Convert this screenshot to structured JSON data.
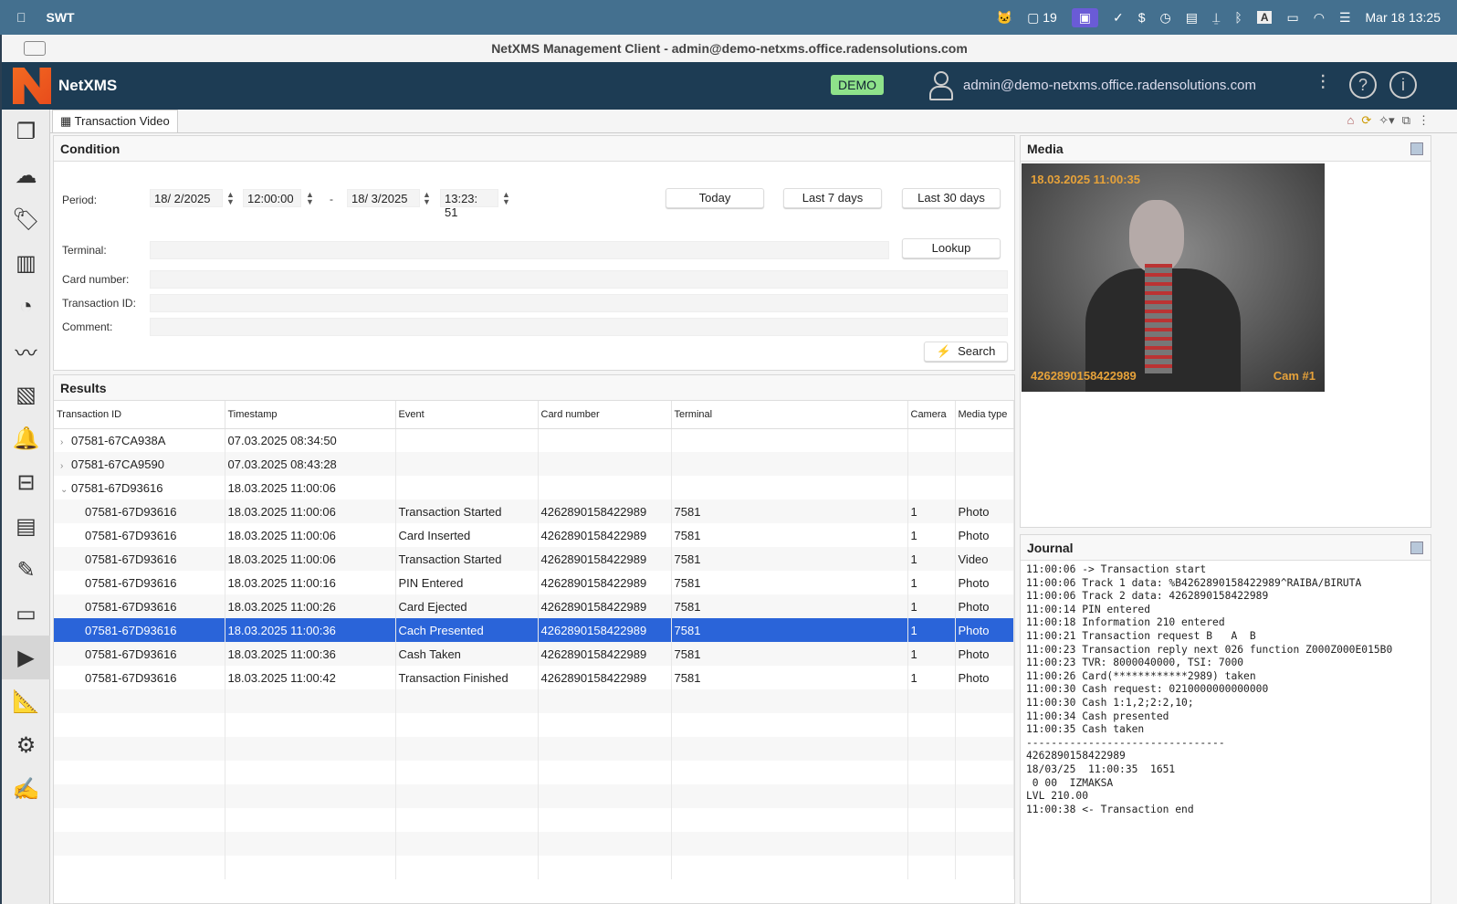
{
  "menubar": {
    "app": "SWT",
    "badge_count": "19",
    "datetime": "Mar 18  13:25",
    "input_indicator": "A"
  },
  "window": {
    "title": "NetXMS Management Client - admin@demo-netxms.office.radensolutions.com"
  },
  "header": {
    "brand": "NetXMS",
    "demo_badge": "DEMO",
    "user": "admin@demo-netxms.office.radensolutions.com"
  },
  "tab": {
    "label": "Transaction Video"
  },
  "condition": {
    "title": "Condition",
    "period_label": "Period:",
    "date_from": "18/ 2/2025",
    "time_from": "12:00:00",
    "separator": "-",
    "date_to": "18/ 3/2025",
    "time_to": "13:23: 51",
    "today": "Today",
    "last7": "Last 7 days",
    "last30": "Last 30 days",
    "terminal_label": "Terminal:",
    "terminal_value": "",
    "lookup": "Lookup",
    "card_label": "Card number:",
    "card_value": "",
    "txid_label": "Transaction ID:",
    "txid_value": "",
    "comment_label": "Comment:",
    "comment_value": "",
    "search": "Search"
  },
  "results": {
    "title": "Results",
    "columns": [
      "Transaction ID",
      "Timestamp",
      "Event",
      "Card number",
      "Terminal",
      "Camera",
      "Media type"
    ],
    "rows": [
      {
        "level": 0,
        "expand": "›",
        "cells": [
          "07581-67CA938A",
          "07.03.2025 08:34:50",
          "",
          "",
          "",
          "",
          ""
        ]
      },
      {
        "level": 0,
        "expand": "›",
        "cells": [
          "07581-67CA9590",
          "07.03.2025 08:43:28",
          "",
          "",
          "",
          "",
          ""
        ]
      },
      {
        "level": 0,
        "expand": "⌄",
        "cells": [
          "07581-67D93616",
          "18.03.2025 11:00:06",
          "",
          "",
          "",
          "",
          ""
        ]
      },
      {
        "level": 1,
        "cells": [
          "07581-67D93616",
          "18.03.2025 11:00:06",
          "Transaction Started",
          "4262890158422989",
          "7581",
          "1",
          "Photo"
        ]
      },
      {
        "level": 1,
        "cells": [
          "07581-67D93616",
          "18.03.2025 11:00:06",
          "Card Inserted",
          "4262890158422989",
          "7581",
          "1",
          "Photo"
        ]
      },
      {
        "level": 1,
        "cells": [
          "07581-67D93616",
          "18.03.2025 11:00:06",
          "Transaction Started",
          "4262890158422989",
          "7581",
          "1",
          "Video"
        ]
      },
      {
        "level": 1,
        "cells": [
          "07581-67D93616",
          "18.03.2025 11:00:16",
          "PIN Entered",
          "4262890158422989",
          "7581",
          "1",
          "Photo"
        ]
      },
      {
        "level": 1,
        "cells": [
          "07581-67D93616",
          "18.03.2025 11:00:26",
          "Card Ejected",
          "4262890158422989",
          "7581",
          "1",
          "Photo"
        ]
      },
      {
        "level": 1,
        "selected": true,
        "cells": [
          "07581-67D93616",
          "18.03.2025 11:00:36",
          "Cach Presented",
          "4262890158422989",
          "7581",
          "1",
          "Photo"
        ]
      },
      {
        "level": 1,
        "cells": [
          "07581-67D93616",
          "18.03.2025 11:00:36",
          "Cash Taken",
          "4262890158422989",
          "7581",
          "1",
          "Photo"
        ]
      },
      {
        "level": 1,
        "cells": [
          "07581-67D93616",
          "18.03.2025 11:00:42",
          "Transaction Finished",
          "4262890158422989",
          "7581",
          "1",
          "Photo"
        ]
      }
    ]
  },
  "media": {
    "title": "Media",
    "overlay_timestamp": "18.03.2025 11:00:35",
    "overlay_card": "4262890158422989",
    "overlay_camera": "Cam #1"
  },
  "journal": {
    "title": "Journal",
    "text": "11:00:06 -> Transaction start\n11:00:06 Track 1 data: %B4262890158422989^RAIBA/BIRUTA\n11:00:06 Track 2 data: 4262890158422989\n11:00:14 PIN entered\n11:00:18 Information 210 entered\n11:00:21 Transaction request B   A  B\n11:00:23 Transaction reply next 026 function Z000Z000E015B0\n11:00:23 TVR: 8000040000, TSI: 7000\n11:00:26 Card(************2989) taken\n11:00:30 Cash request: 0210000000000000\n11:00:30 Cash 1:1,2;2:2,10;\n11:00:34 Cash presented\n11:00:35 Cash taken\n--------------------------------\n4262890158422989\n18/03/25  11:00:35  1651\n 0 00  IZMAKSA\nLVL 210.00\n11:00:38 <- Transaction end"
  }
}
